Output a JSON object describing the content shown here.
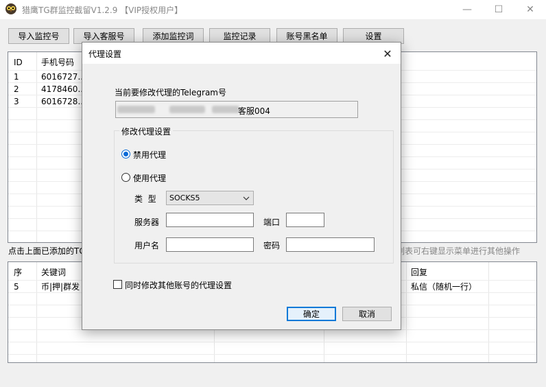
{
  "window": {
    "title": "猎鹰TG群监控截留V1.2.9   【VIP授权用户】",
    "app_icon": "owl-icon",
    "min_symbol": "—",
    "max_symbol": "☐",
    "close_symbol": "✕"
  },
  "toolbar": {
    "import_monitor": "导入监控号",
    "import_service": "导入客服号",
    "add_keyword": "添加监控词",
    "monitor_log": "监控记录",
    "account_blacklist": "账号黑名单",
    "settings": "设置"
  },
  "accounts_table": {
    "headers": [
      "ID",
      "手机号码"
    ],
    "rows": [
      {
        "id": "1",
        "phone": "6016727..."
      },
      {
        "id": "2",
        "phone": "4178460..."
      },
      {
        "id": "3",
        "phone": "6016728..."
      }
    ]
  },
  "hints": {
    "left": "点击上面已添加的TG",
    "right": "列表可右键显示菜单进行其他操作"
  },
  "keywords_table": {
    "headers": {
      "seq": "序",
      "keyword": "关键词",
      "reply": "回复"
    },
    "rows": [
      {
        "seq": "5",
        "keyword": "币|押|群发",
        "reply": "私信（随机一行）"
      }
    ]
  },
  "dialog": {
    "title": "代理设置",
    "close_symbol": "✕",
    "current_label": "当前要修改代理的Telegram号",
    "current_value": "客服004",
    "group_label": "修改代理设置",
    "disable_proxy": "禁用代理",
    "use_proxy": "使用代理",
    "type_label": "类  型",
    "type_value": "SOCKS5",
    "server_label": "服务器",
    "server_value": "",
    "port_label": "端口",
    "port_value": "",
    "username_label": "用户名",
    "username_value": "",
    "password_label": "密码",
    "password_value": "",
    "also_modify_label": "同时修改其他账号的代理设置",
    "ok_label": "确定",
    "cancel_label": "取消",
    "selected_option": "disable_proxy"
  },
  "colors": {
    "accent": "#0078d7",
    "radio_dot": "#0a6ad6"
  }
}
